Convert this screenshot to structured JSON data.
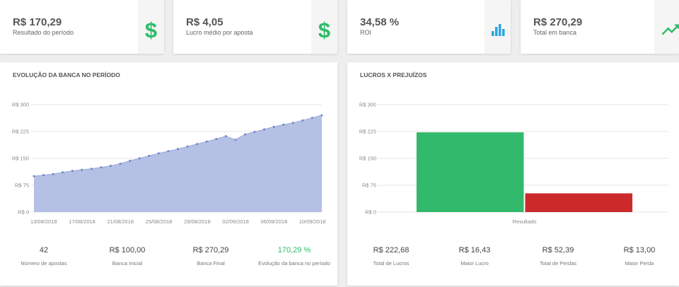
{
  "stat_cards": [
    {
      "value": "R$ 170,29",
      "label": "Resultado do período",
      "icon": "dollar-icon",
      "icon_glyph": "$",
      "icon_color": "#2dbc69"
    },
    {
      "value": "R$ 4,05",
      "label": "Lucro médio por aposta",
      "icon": "dollar-icon",
      "icon_glyph": "$",
      "icon_color": "#2dbc69"
    },
    {
      "value": "34,58 %",
      "label": "ROI",
      "icon": "bar-chart-icon",
      "icon_color": "#2ba6df"
    },
    {
      "value": "R$ 270,29",
      "label": "Total em banca",
      "icon": "trending-up-icon",
      "icon_color": "#2dbc69"
    }
  ],
  "evolution_panel": {
    "stats": [
      {
        "value": "42",
        "label": "Número de apostas"
      },
      {
        "value": "R$ 100,00",
        "label": "Banca Inicial"
      },
      {
        "value": "R$ 270,29",
        "label": "Banca Final"
      },
      {
        "value": "170,29 %",
        "label": "Evolução da banca no período",
        "color": "#2dbc69"
      }
    ]
  },
  "profit_loss_panel": {
    "stats": [
      {
        "value": "R$ 222,68",
        "label": "Total de Lucros"
      },
      {
        "value": "R$ 16,43",
        "label": "Maior Lucro"
      },
      {
        "value": "R$ 52,39",
        "label": "Total de Perdas"
      },
      {
        "value": "R$ 13,00",
        "label": "Maior Perda"
      }
    ]
  },
  "chart_data": [
    {
      "type": "area",
      "title": "EVOLUÇÃO DA BANCA NO PERÍODO",
      "points": [
        {
          "x": "13/08/2018",
          "y": 100
        },
        {
          "x": "14/08/2018",
          "y": 103
        },
        {
          "x": "15/08/2018",
          "y": 106
        },
        {
          "x": "16/08/2018",
          "y": 111
        },
        {
          "x": "17/08/2018",
          "y": 115
        },
        {
          "x": "18/08/2018",
          "y": 118
        },
        {
          "x": "19/08/2018",
          "y": 121
        },
        {
          "x": "20/08/2018",
          "y": 125
        },
        {
          "x": "21/08/2018",
          "y": 129
        },
        {
          "x": "22/08/2018",
          "y": 135
        },
        {
          "x": "23/08/2018",
          "y": 143
        },
        {
          "x": "24/08/2018",
          "y": 150
        },
        {
          "x": "25/08/2018",
          "y": 157
        },
        {
          "x": "26/08/2018",
          "y": 164
        },
        {
          "x": "27/08/2018",
          "y": 170
        },
        {
          "x": "28/08/2018",
          "y": 176
        },
        {
          "x": "29/08/2018",
          "y": 183
        },
        {
          "x": "30/08/2018",
          "y": 190
        },
        {
          "x": "31/08/2018",
          "y": 197
        },
        {
          "x": "01/09/2018",
          "y": 204
        },
        {
          "x": "02/09/2018",
          "y": 212
        },
        {
          "x": "03/09/2018",
          "y": 202
        },
        {
          "x": "04/09/2018",
          "y": 217
        },
        {
          "x": "05/09/2018",
          "y": 224
        },
        {
          "x": "06/09/2018",
          "y": 231
        },
        {
          "x": "07/09/2018",
          "y": 238
        },
        {
          "x": "08/09/2018",
          "y": 244
        },
        {
          "x": "09/09/2018",
          "y": 249
        },
        {
          "x": "10/09/2018",
          "y": 256
        },
        {
          "x": "11/09/2018",
          "y": 263
        },
        {
          "x": "12/09/2018",
          "y": 270.29
        }
      ],
      "x_tick_labels": [
        "13/08/2018",
        "17/08/2018",
        "21/08/2018",
        "25/08/2018",
        "29/08/2018",
        "02/09/2018",
        "06/09/2018",
        "10/09/2018"
      ],
      "y_ticks": [
        {
          "value": 0,
          "label": "R$ 0"
        },
        {
          "value": 75,
          "label": "R$ 75"
        },
        {
          "value": 150,
          "label": "R$ 150"
        },
        {
          "value": 225,
          "label": "R$ 225"
        },
        {
          "value": 300,
          "label": "R$ 300"
        }
      ],
      "ylim": [
        0,
        300
      ],
      "grid": true,
      "fill_color": "#b4c0e4",
      "line_color": "#98a7d9",
      "point_color": "#7184c6"
    },
    {
      "type": "bar",
      "title": "LUCROS X PREJUÍZOS",
      "categories": [
        "Resultado"
      ],
      "series": [
        {
          "values": [
            222.68
          ],
          "color": "#33b96b"
        },
        {
          "values": [
            52.39
          ],
          "color": "#cc2a2a"
        }
      ],
      "y_ticks": [
        {
          "value": 0,
          "label": "R$ 0"
        },
        {
          "value": 75,
          "label": "R$ 75"
        },
        {
          "value": 150,
          "label": "R$ 150"
        },
        {
          "value": 225,
          "label": "R$ 225"
        },
        {
          "value": 300,
          "label": "R$ 300"
        }
      ],
      "ylim": [
        0,
        300
      ],
      "grid": true
    }
  ]
}
